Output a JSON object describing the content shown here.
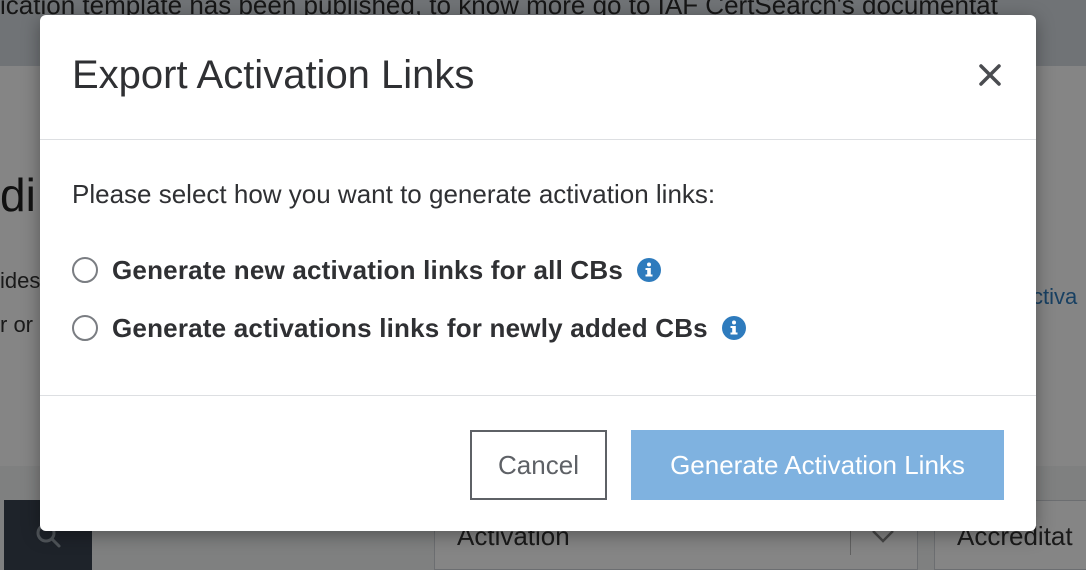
{
  "background": {
    "banner_text": "ication template has been published, to know more go to IAF CertSearch's documentat",
    "heading_fragment": "di",
    "text_fragment_1": "ides",
    "text_fragment_2": "r or",
    "link_fragment": "ctiva",
    "select_value": "Activation",
    "select2_value": "Accreditat"
  },
  "modal": {
    "title": "Export Activation Links",
    "prompt": "Please select how you want to generate activation links:",
    "options": [
      {
        "label": "Generate new activation links for all CBs",
        "selected": false
      },
      {
        "label": "Generate activations links for newly added CBs",
        "selected": false
      }
    ],
    "cancel_label": "Cancel",
    "generate_label": "Generate Activation Links"
  },
  "colors": {
    "primary_button": "#7fb2e0",
    "info_icon": "#2e7bbd",
    "overlay": "rgba(0,0,0,0.48)"
  },
  "icons": {
    "close": "close-icon",
    "info": "info-icon",
    "search": "search-icon",
    "chevron": "chevron-down-icon"
  }
}
